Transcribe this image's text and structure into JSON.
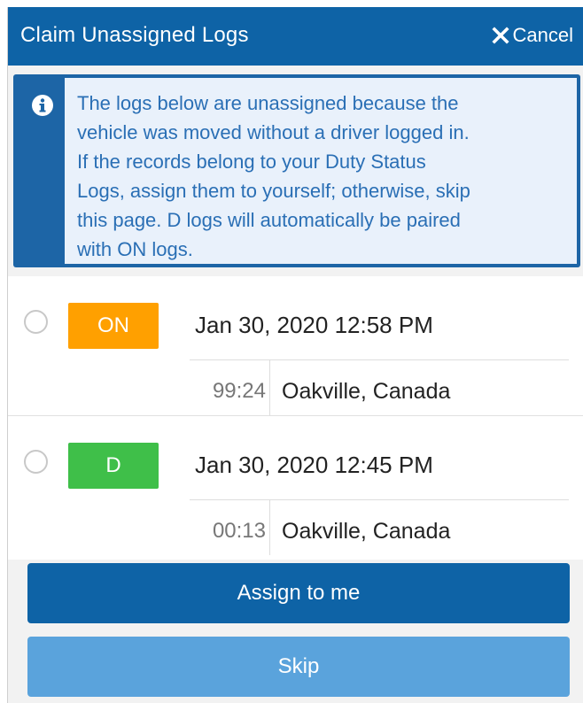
{
  "header": {
    "title": "Claim Unassigned Logs",
    "cancel_label": "Cancel",
    "cancel_icon": "close-icon"
  },
  "notice": {
    "icon": "info-icon",
    "lines": [
      "The logs below are unassigned because the",
      "vehicle was moved without a driver logged in.",
      "If the records belong to your Duty Status",
      "Logs, assign them to yourself; otherwise, skip",
      "this page. D logs will automatically be paired",
      "with ON logs."
    ]
  },
  "logs": [
    {
      "status": "ON",
      "status_color": "#ffa000",
      "datetime": "Jan 30, 2020 12:58 PM",
      "duration": "99:24",
      "location": "Oakville, Canada",
      "selected": false
    },
    {
      "status": "D",
      "status_color": "#3fbf49",
      "datetime": "Jan 30, 2020 12:45 PM",
      "duration": "00:13",
      "location": "Oakville, Canada",
      "selected": false
    }
  ],
  "buttons": {
    "assign_label": "Assign to me",
    "skip_label": "Skip"
  },
  "colors": {
    "primary": "#0e63a6",
    "skip": "#5aa3dc",
    "notice_bg": "#e9f1fb",
    "notice_text": "#2a6fb5"
  }
}
